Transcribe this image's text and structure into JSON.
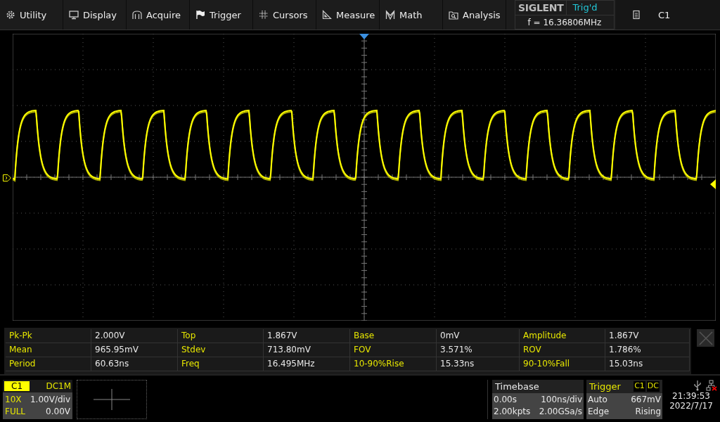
{
  "menu": [
    {
      "label": "Utility",
      "kind": "gear"
    },
    {
      "label": "Display",
      "kind": "monitor"
    },
    {
      "label": "Acquire",
      "kind": "acquire"
    },
    {
      "label": "Trigger",
      "kind": "flag"
    },
    {
      "label": "Cursors",
      "kind": "grid"
    },
    {
      "label": "Measure",
      "kind": "ruler"
    },
    {
      "label": "Math",
      "kind": "math"
    },
    {
      "label": "Analysis",
      "kind": "analysis"
    }
  ],
  "header": {
    "brand": "SIGLENT",
    "trigger_status": "Trig'd",
    "frequency": "f = 16.36806MHz",
    "channel": "C1"
  },
  "measurements": [
    [
      {
        "label": "Pk-Pk",
        "value": "2.000V"
      },
      {
        "label": "Top",
        "value": "1.867V"
      },
      {
        "label": "Base",
        "value": "0mV"
      },
      {
        "label": "Amplitude",
        "value": "1.867V"
      }
    ],
    [
      {
        "label": "Mean",
        "value": "965.95mV"
      },
      {
        "label": "Stdev",
        "value": "713.80mV"
      },
      {
        "label": "FOV",
        "value": "3.571%"
      },
      {
        "label": "ROV",
        "value": "1.786%"
      }
    ],
    [
      {
        "label": "Period",
        "value": "60.63ns"
      },
      {
        "label": "Freq",
        "value": "16.495MHz"
      },
      {
        "label": "10-90%Rise",
        "value": "15.33ns"
      },
      {
        "label": "90-10%Fall",
        "value": "15.03ns"
      }
    ]
  ],
  "channel": {
    "name": "C1",
    "coupling": "DC1M",
    "probe": "10X",
    "scale": "1.00V/div",
    "bandwidth": "FULL",
    "offset": "0.00V"
  },
  "timebase": {
    "title": "Timebase",
    "delay": "0.00s",
    "scale": "100ns/div",
    "points": "2.00kpts",
    "rate": "2.00GSa/s"
  },
  "trigger": {
    "title": "Trigger",
    "source": "C1",
    "coupling": "DC",
    "mode": "Auto",
    "level": "667mV",
    "type": "Edge",
    "slope": "Rising"
  },
  "clock": {
    "time": "21:39:53",
    "date": "2022/7/17"
  }
}
